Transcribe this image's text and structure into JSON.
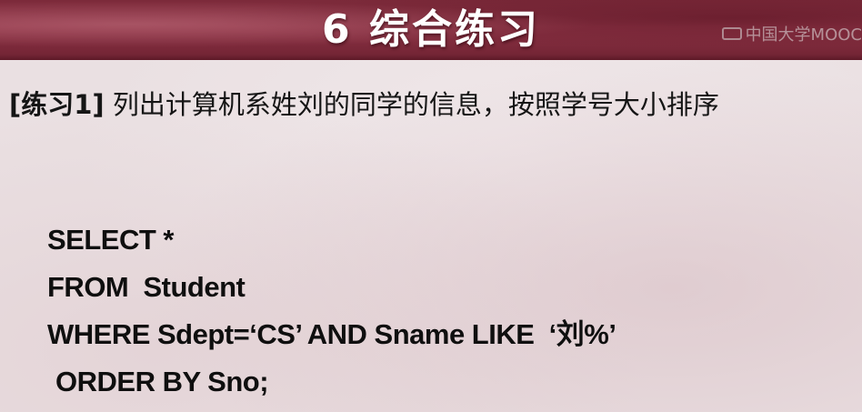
{
  "slide": {
    "title": "6 综合练习",
    "watermark": "中国大学MOOC",
    "exercise": {
      "tag": "[练习1]",
      "text": " 列出计算机系姓刘的同学的信息，按照学号大小排序"
    },
    "sql_lines": [
      "SELECT *",
      "FROM  Student",
      "WHERE Sdept=‘CS’ AND Sname LIKE  ‘刘%’",
      "ORDER BY Sno;"
    ]
  },
  "colors": {
    "title_band": "#8e3446",
    "title_text": "#ffffff",
    "body_text": "#151515",
    "background": "#eae0e2"
  }
}
